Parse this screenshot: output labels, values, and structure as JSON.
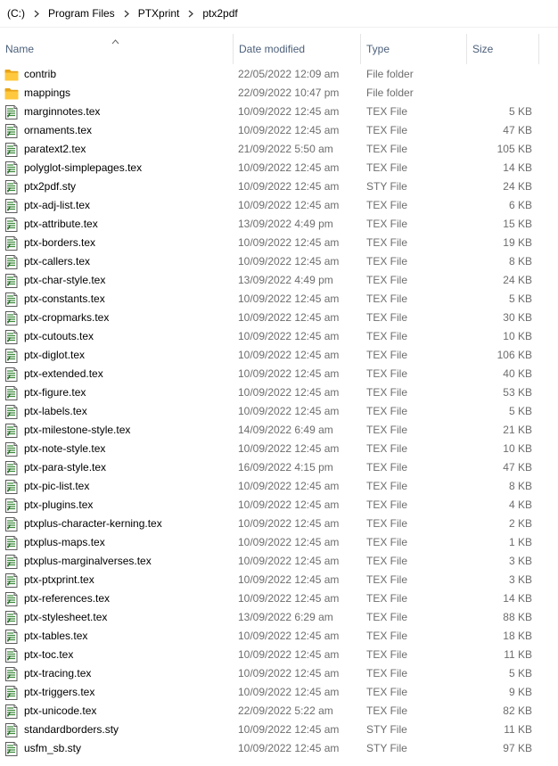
{
  "breadcrumb": [
    "(C:)",
    "Program Files",
    "PTXprint",
    "ptx2pdf"
  ],
  "columns": {
    "name": "Name",
    "date": "Date modified",
    "type": "Type",
    "size": "Size"
  },
  "files": [
    {
      "name": "contrib",
      "date": "22/05/2022 12:09 am",
      "type": "File folder",
      "size": "",
      "icon": "folder-icon"
    },
    {
      "name": "mappings",
      "date": "22/09/2022 10:47 pm",
      "type": "File folder",
      "size": "",
      "icon": "folder-icon"
    },
    {
      "name": "marginnotes.tex",
      "date": "10/09/2022 12:45 am",
      "type": "TEX File",
      "size": "5 KB",
      "icon": "tex-file-icon"
    },
    {
      "name": "ornaments.tex",
      "date": "10/09/2022 12:45 am",
      "type": "TEX File",
      "size": "47 KB",
      "icon": "tex-file-icon"
    },
    {
      "name": "paratext2.tex",
      "date": "21/09/2022 5:50 am",
      "type": "TEX File",
      "size": "105 KB",
      "icon": "tex-file-icon"
    },
    {
      "name": "polyglot-simplepages.tex",
      "date": "10/09/2022 12:45 am",
      "type": "TEX File",
      "size": "14 KB",
      "icon": "tex-file-icon"
    },
    {
      "name": "ptx2pdf.sty",
      "date": "10/09/2022 12:45 am",
      "type": "STY File",
      "size": "24 KB",
      "icon": "tex-file-icon"
    },
    {
      "name": "ptx-adj-list.tex",
      "date": "10/09/2022 12:45 am",
      "type": "TEX File",
      "size": "6 KB",
      "icon": "tex-file-icon"
    },
    {
      "name": "ptx-attribute.tex",
      "date": "13/09/2022 4:49 pm",
      "type": "TEX File",
      "size": "15 KB",
      "icon": "tex-file-icon"
    },
    {
      "name": "ptx-borders.tex",
      "date": "10/09/2022 12:45 am",
      "type": "TEX File",
      "size": "19 KB",
      "icon": "tex-file-icon"
    },
    {
      "name": "ptx-callers.tex",
      "date": "10/09/2022 12:45 am",
      "type": "TEX File",
      "size": "8 KB",
      "icon": "tex-file-icon"
    },
    {
      "name": "ptx-char-style.tex",
      "date": "13/09/2022 4:49 pm",
      "type": "TEX File",
      "size": "24 KB",
      "icon": "tex-file-icon"
    },
    {
      "name": "ptx-constants.tex",
      "date": "10/09/2022 12:45 am",
      "type": "TEX File",
      "size": "5 KB",
      "icon": "tex-file-icon"
    },
    {
      "name": "ptx-cropmarks.tex",
      "date": "10/09/2022 12:45 am",
      "type": "TEX File",
      "size": "30 KB",
      "icon": "tex-file-icon"
    },
    {
      "name": "ptx-cutouts.tex",
      "date": "10/09/2022 12:45 am",
      "type": "TEX File",
      "size": "10 KB",
      "icon": "tex-file-icon"
    },
    {
      "name": "ptx-diglot.tex",
      "date": "10/09/2022 12:45 am",
      "type": "TEX File",
      "size": "106 KB",
      "icon": "tex-file-icon"
    },
    {
      "name": "ptx-extended.tex",
      "date": "10/09/2022 12:45 am",
      "type": "TEX File",
      "size": "40 KB",
      "icon": "tex-file-icon"
    },
    {
      "name": "ptx-figure.tex",
      "date": "10/09/2022 12:45 am",
      "type": "TEX File",
      "size": "53 KB",
      "icon": "tex-file-icon"
    },
    {
      "name": "ptx-labels.tex",
      "date": "10/09/2022 12:45 am",
      "type": "TEX File",
      "size": "5 KB",
      "icon": "tex-file-icon"
    },
    {
      "name": "ptx-milestone-style.tex",
      "date": "14/09/2022 6:49 am",
      "type": "TEX File",
      "size": "21 KB",
      "icon": "tex-file-icon"
    },
    {
      "name": "ptx-note-style.tex",
      "date": "10/09/2022 12:45 am",
      "type": "TEX File",
      "size": "10 KB",
      "icon": "tex-file-icon"
    },
    {
      "name": "ptx-para-style.tex",
      "date": "16/09/2022 4:15 pm",
      "type": "TEX File",
      "size": "47 KB",
      "icon": "tex-file-icon"
    },
    {
      "name": "ptx-pic-list.tex",
      "date": "10/09/2022 12:45 am",
      "type": "TEX File",
      "size": "8 KB",
      "icon": "tex-file-icon"
    },
    {
      "name": "ptx-plugins.tex",
      "date": "10/09/2022 12:45 am",
      "type": "TEX File",
      "size": "4 KB",
      "icon": "tex-file-icon"
    },
    {
      "name": "ptxplus-character-kerning.tex",
      "date": "10/09/2022 12:45 am",
      "type": "TEX File",
      "size": "2 KB",
      "icon": "tex-file-icon"
    },
    {
      "name": "ptxplus-maps.tex",
      "date": "10/09/2022 12:45 am",
      "type": "TEX File",
      "size": "1 KB",
      "icon": "tex-file-icon"
    },
    {
      "name": "ptxplus-marginalverses.tex",
      "date": "10/09/2022 12:45 am",
      "type": "TEX File",
      "size": "3 KB",
      "icon": "tex-file-icon"
    },
    {
      "name": "ptx-ptxprint.tex",
      "date": "10/09/2022 12:45 am",
      "type": "TEX File",
      "size": "3 KB",
      "icon": "tex-file-icon"
    },
    {
      "name": "ptx-references.tex",
      "date": "10/09/2022 12:45 am",
      "type": "TEX File",
      "size": "14 KB",
      "icon": "tex-file-icon"
    },
    {
      "name": "ptx-stylesheet.tex",
      "date": "13/09/2022 6:29 am",
      "type": "TEX File",
      "size": "88 KB",
      "icon": "tex-file-icon"
    },
    {
      "name": "ptx-tables.tex",
      "date": "10/09/2022 12:45 am",
      "type": "TEX File",
      "size": "18 KB",
      "icon": "tex-file-icon"
    },
    {
      "name": "ptx-toc.tex",
      "date": "10/09/2022 12:45 am",
      "type": "TEX File",
      "size": "11 KB",
      "icon": "tex-file-icon"
    },
    {
      "name": "ptx-tracing.tex",
      "date": "10/09/2022 12:45 am",
      "type": "TEX File",
      "size": "5 KB",
      "icon": "tex-file-icon"
    },
    {
      "name": "ptx-triggers.tex",
      "date": "10/09/2022 12:45 am",
      "type": "TEX File",
      "size": "9 KB",
      "icon": "tex-file-icon"
    },
    {
      "name": "ptx-unicode.tex",
      "date": "22/09/2022 5:22 am",
      "type": "TEX File",
      "size": "82 KB",
      "icon": "tex-file-icon"
    },
    {
      "name": "standardborders.sty",
      "date": "10/09/2022 12:45 am",
      "type": "STY File",
      "size": "11 KB",
      "icon": "tex-file-icon"
    },
    {
      "name": "usfm_sb.sty",
      "date": "10/09/2022 12:45 am",
      "type": "STY File",
      "size": "97 KB",
      "icon": "tex-file-icon"
    }
  ],
  "colors": {
    "header_text": "#4c607a",
    "secondary_text": "#6d6d6d",
    "folder": "#ffc83d",
    "tex_icon_green": "#3c8b3c"
  }
}
